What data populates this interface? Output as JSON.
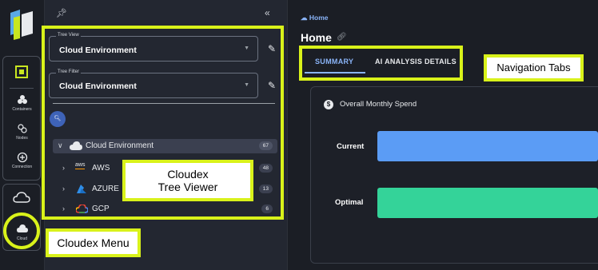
{
  "rail": {
    "items": [
      {
        "label": "Containers",
        "icon": "containers-icon"
      },
      {
        "label": "Nodes",
        "icon": "nodes-icon"
      },
      {
        "label": "Connection",
        "icon": "connection-icon"
      },
      {
        "label": "Cloud",
        "icon": "cloud-icon"
      }
    ]
  },
  "tree_panel": {
    "tree_view": {
      "label": "Tree View",
      "value": "Cloud Environment"
    },
    "tree_filter": {
      "label": "Tree Filter",
      "value": "Cloud Environment"
    },
    "nodes": [
      {
        "label": "Cloud Environment",
        "count": "67",
        "expanded": true,
        "icon": "cloud-icon"
      },
      {
        "label": "AWS",
        "count": "48",
        "icon": "aws-icon"
      },
      {
        "label": "AZURE",
        "count": "13",
        "icon": "azure-icon"
      },
      {
        "label": "GCP",
        "count": "6",
        "icon": "gcp-icon"
      }
    ]
  },
  "main": {
    "breadcrumb": "Home",
    "title": "Home",
    "tabs": [
      {
        "label": "SUMMARY",
        "active": true
      },
      {
        "label": "AI ANALYSIS DETAILS",
        "active": false
      }
    ],
    "card": {
      "title": "Overall Monthly Spend",
      "bars": [
        {
          "label": "Current",
          "color": "#5b9cf5"
        },
        {
          "label": "Optimal",
          "color": "#34d399"
        }
      ]
    }
  },
  "annotations": {
    "tree": [
      "Cloudex",
      "Tree Viewer"
    ],
    "tabs": "Navigation Tabs",
    "menu": "Cloudex Menu",
    "color": "#d9f21a"
  }
}
